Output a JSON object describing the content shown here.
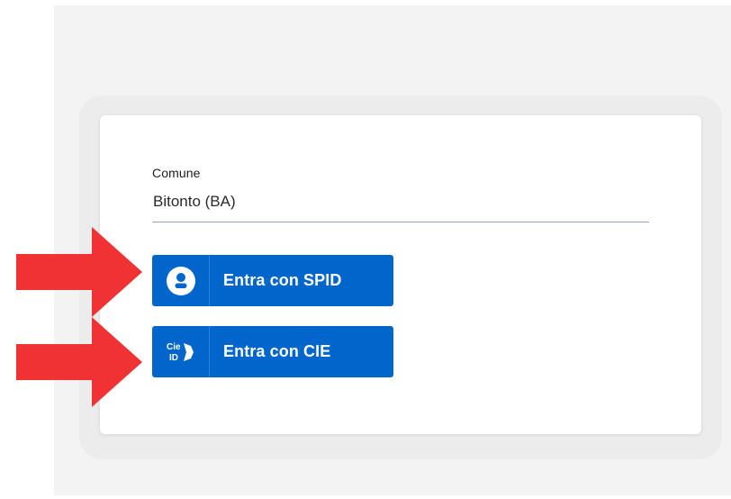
{
  "login_form": {
    "comune_label": "Comune",
    "comune_value": "Bitonto (BA)",
    "spid_button_label": "Entra con SPID",
    "cie_button_label": "Entra con CIE",
    "cie_logo_top": "Cie",
    "cie_logo_bottom": "ID"
  },
  "icons": {
    "spid": "user-circle-icon",
    "cie": "cie-id-icon",
    "annotation": "red-arrow-icon"
  },
  "colors": {
    "primary_blue": "#0066cc",
    "annotation_red": "#f03232",
    "page_gray": "#f3f3f4"
  }
}
